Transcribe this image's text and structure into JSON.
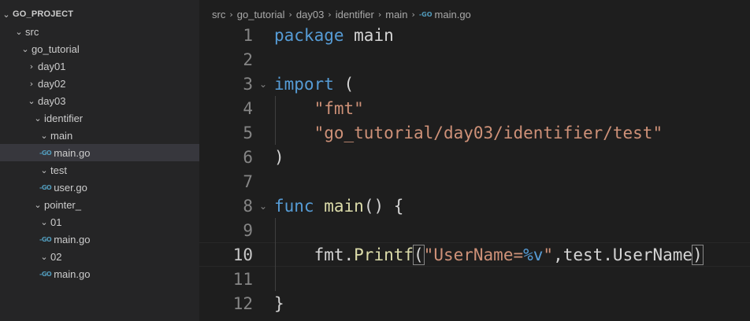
{
  "explorer": {
    "root": "GO_PROJECT",
    "items": [
      {
        "label": "src",
        "chevron": "⌄",
        "icon": ""
      },
      {
        "label": "go_tutorial",
        "chevron": "⌄",
        "icon": ""
      },
      {
        "label": "day01",
        "chevron": "›",
        "icon": ""
      },
      {
        "label": "day02",
        "chevron": "›",
        "icon": ""
      },
      {
        "label": "day03",
        "chevron": "⌄",
        "icon": ""
      },
      {
        "label": "identifier",
        "chevron": "⌄",
        "icon": ""
      },
      {
        "label": "main",
        "chevron": "⌄",
        "icon": ""
      },
      {
        "label": "main.go",
        "chevron": "",
        "icon": "-GO"
      },
      {
        "label": "test",
        "chevron": "⌄",
        "icon": ""
      },
      {
        "label": "user.go",
        "chevron": "",
        "icon": "-GO"
      },
      {
        "label": "pointer_",
        "chevron": "⌄",
        "icon": ""
      },
      {
        "label": "01",
        "chevron": "⌄",
        "icon": ""
      },
      {
        "label": "main.go",
        "chevron": "",
        "icon": "-GO"
      },
      {
        "label": "02",
        "chevron": "⌄",
        "icon": ""
      },
      {
        "label": "main.go",
        "chevron": "",
        "icon": "-GO"
      }
    ]
  },
  "breadcrumb": {
    "parts": [
      "src",
      "go_tutorial",
      "day03",
      "identifier",
      "main"
    ],
    "file_icon": "-GO",
    "file": "main.go"
  },
  "editor": {
    "lines": [
      {
        "n": "1",
        "fold": "",
        "tokens": [
          [
            "kw",
            "package"
          ],
          [
            "plain",
            " main"
          ]
        ]
      },
      {
        "n": "2",
        "fold": "",
        "tokens": []
      },
      {
        "n": "3",
        "fold": "⌄",
        "tokens": [
          [
            "kw",
            "import"
          ],
          [
            "plain",
            " ("
          ]
        ]
      },
      {
        "n": "4",
        "fold": "",
        "tokens": [
          [
            "plain",
            "    "
          ],
          [
            "str",
            "\"fmt\""
          ]
        ]
      },
      {
        "n": "5",
        "fold": "",
        "tokens": [
          [
            "plain",
            "    "
          ],
          [
            "str",
            "\"go_tutorial/day03/identifier/test\""
          ]
        ]
      },
      {
        "n": "6",
        "fold": "",
        "tokens": [
          [
            "plain",
            ")"
          ]
        ]
      },
      {
        "n": "7",
        "fold": "",
        "tokens": []
      },
      {
        "n": "8",
        "fold": "⌄",
        "tokens": [
          [
            "kw",
            "func"
          ],
          [
            "plain",
            " "
          ],
          [
            "fn",
            "main"
          ],
          [
            "plain",
            "() {"
          ]
        ]
      },
      {
        "n": "9",
        "fold": "",
        "tokens": []
      },
      {
        "n": "10",
        "fold": "",
        "tokens": [
          [
            "plain",
            "    fmt."
          ],
          [
            "fn",
            "Printf"
          ],
          [
            "match",
            "("
          ],
          [
            "str",
            "\"UserName="
          ],
          [
            "kw",
            "%v"
          ],
          [
            "str",
            "\""
          ],
          [
            "plain",
            ",test.UserName"
          ],
          [
            "match",
            ")"
          ]
        ]
      },
      {
        "n": "11",
        "fold": "",
        "tokens": []
      },
      {
        "n": "12",
        "fold": "",
        "tokens": [
          [
            "plain",
            "}"
          ]
        ]
      }
    ],
    "current_line": "10"
  }
}
